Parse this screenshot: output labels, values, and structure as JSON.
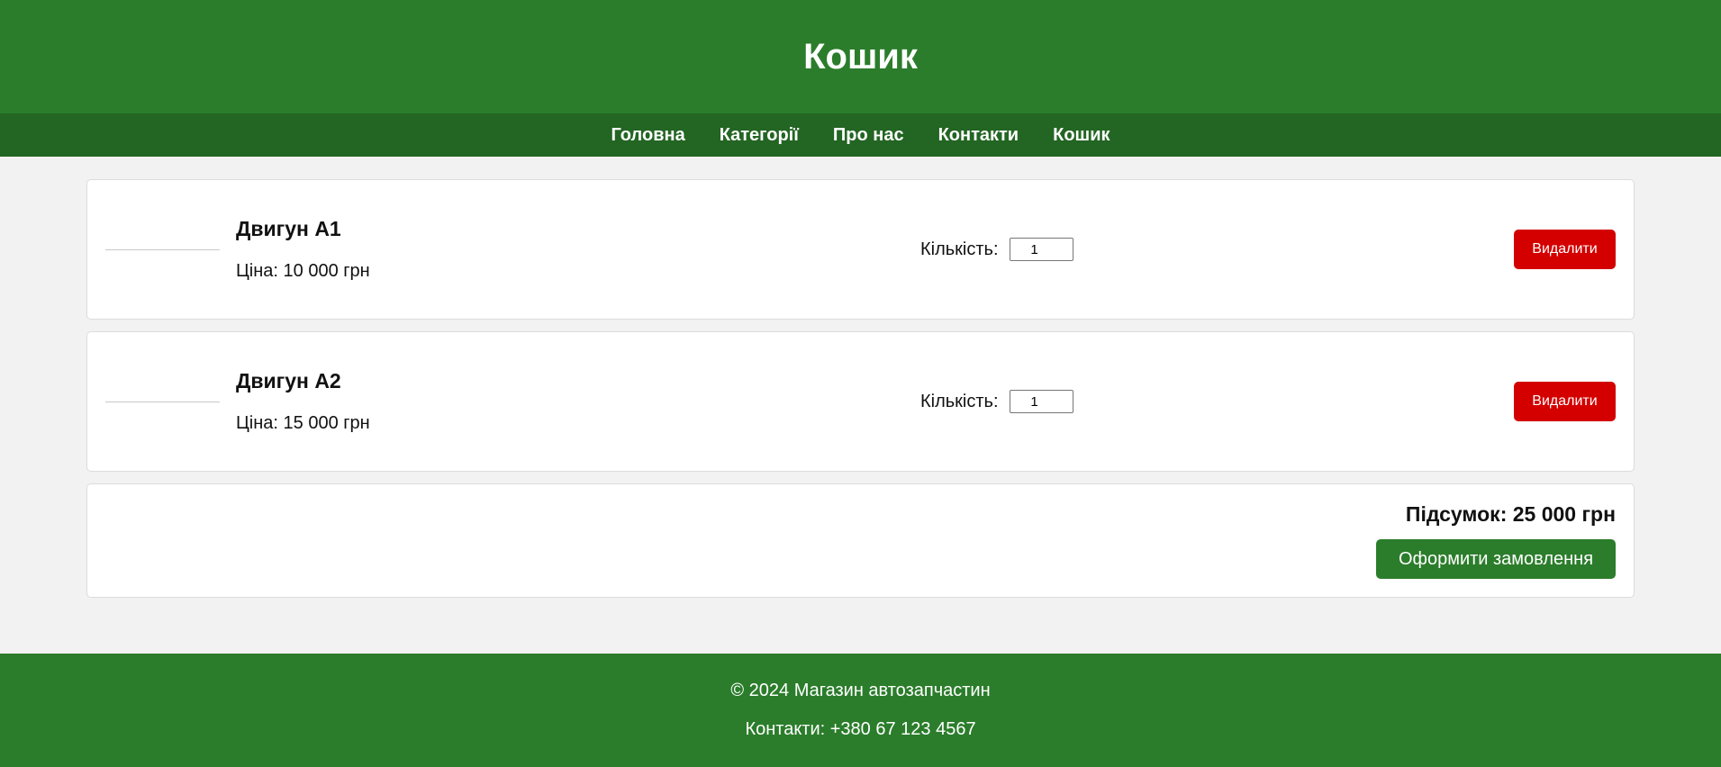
{
  "header": {
    "title": "Кошик"
  },
  "nav": {
    "items": [
      {
        "label": "Головна"
      },
      {
        "label": "Категорії"
      },
      {
        "label": "Про нас"
      },
      {
        "label": "Контакти"
      },
      {
        "label": "Кошик"
      }
    ]
  },
  "cart": {
    "items": [
      {
        "name": "Двигун A1",
        "price": "Ціна: 10 000 грн",
        "quantity_label": "Кількість:",
        "quantity": "1",
        "remove_label": "Видалити"
      },
      {
        "name": "Двигун A2",
        "price": "Ціна: 15 000 грн",
        "quantity_label": "Кількість:",
        "quantity": "1",
        "remove_label": "Видалити"
      }
    ]
  },
  "summary": {
    "total": "Підсумок: 25 000 грн",
    "checkout_label": "Оформити замовлення"
  },
  "footer": {
    "copyright": "© 2024 Магазин автозапчастин",
    "contacts": "Контакти: +380 67 123 4567"
  },
  "colors": {
    "primary_green": "#2b7d2b",
    "nav_green": "#236523",
    "danger_red": "#d40000",
    "background": "#f2f2f2"
  }
}
